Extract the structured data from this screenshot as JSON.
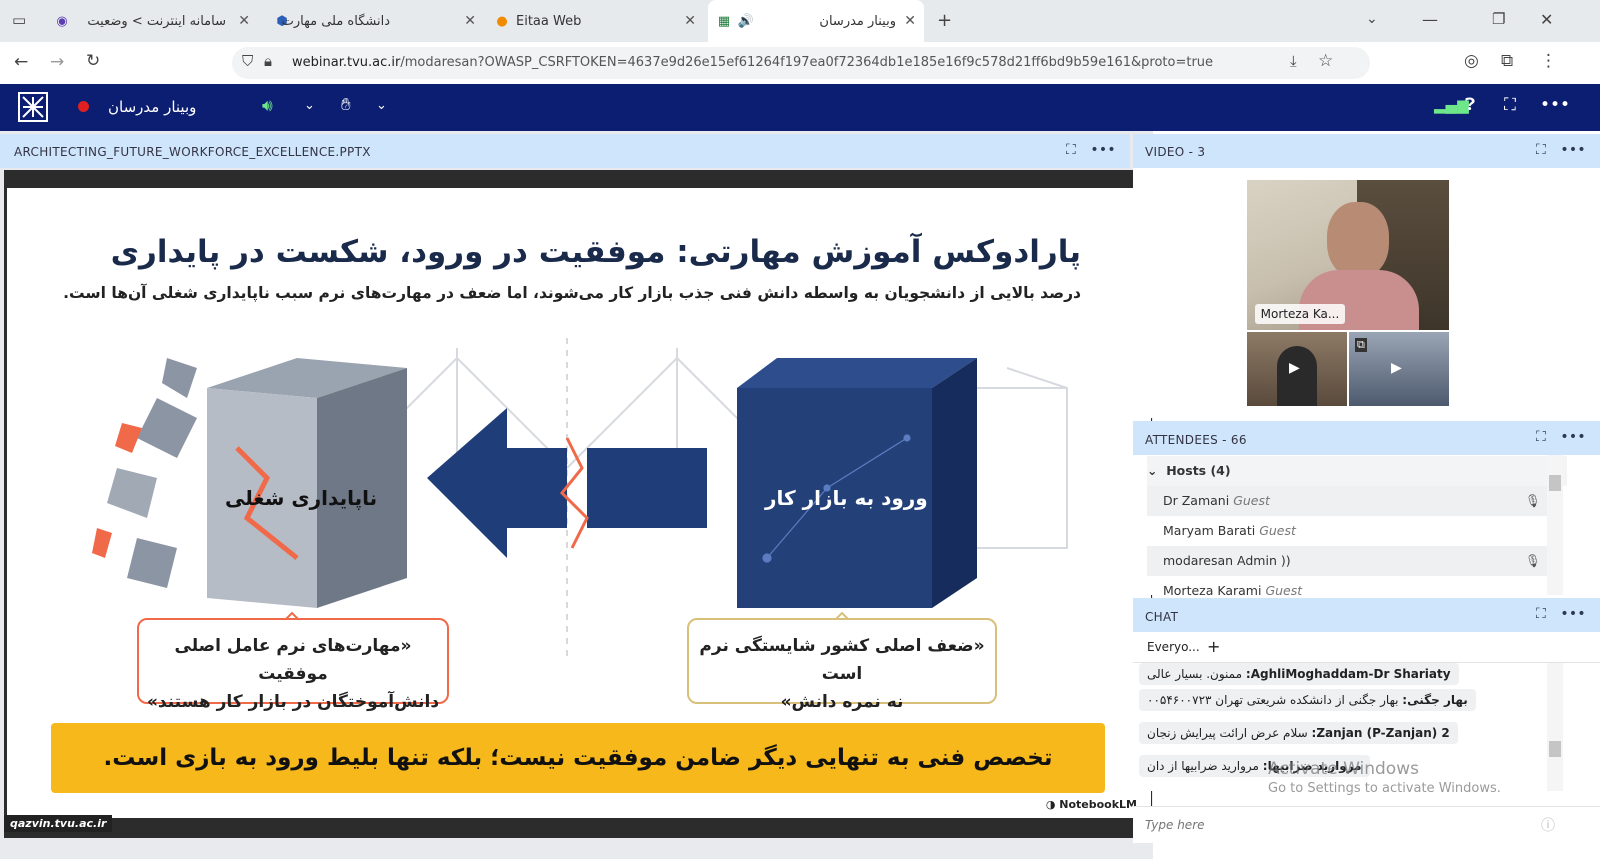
{
  "browser": {
    "tabs": [
      {
        "title": "سامانه اینترنت > وضعیت"
      },
      {
        "title": "دانشگاه ملی مهارت"
      },
      {
        "title": "Eitaa Web"
      },
      {
        "title": "وبینار مدرسان"
      }
    ],
    "url_host": "webinar.tvu.ac.ir",
    "url_rest": "/modaresan?OWASP_CSRFTOKEN=4637e9d26e15ef61264f197ea0f72364db1e185e16f9c578d21ff6bd9b59e161&proto=true"
  },
  "app": {
    "room_title": "وبینار مدرسان",
    "colors": {
      "header": "#0b1e72",
      "panel_head": "#cfe5fb",
      "accent": "#f6b81b",
      "record": "#e02020"
    }
  },
  "presentation": {
    "filename": "ARCHITECTING_FUTURE_WORKFORCE_EXCELLENCE.PPTX",
    "slide": {
      "title": "پارادوکس آموزش مهارتی: موفقیت در ورود، شکست در پایداری",
      "subtitle": "درصد بالایی از دانشجویان به واسطه دانش فنی جذب بازار کار می‌شوند، اما ضعف در مهارت‌های نرم سبب ناپایداری شغلی آن‌ها است.",
      "left_cube_label": "ناپایداری شغلی",
      "right_cube_label": "ورود به بازار کار",
      "left_quote_line1": "«مهارت‌های نرم عامل اصلی موفقیت",
      "left_quote_line2": "دانش‌آموختگان در بازار کار هستند»",
      "right_quote_line1": "«ضعف اصلی کشور شایستگی نرم است",
      "right_quote_line2": "نه نمره دانش»",
      "banner": "تخصص فنی به تنهایی دیگر ضامن موفقیت نیست؛ بلکه تنها بلیط ورود به بازی است.",
      "credit": "NotebookLM"
    },
    "watermark": "qazvin.tvu.ac.ir"
  },
  "video": {
    "label": "VIDEO",
    "count": "- 3",
    "main_name": "Morteza Ka..."
  },
  "attendees": {
    "label": "ATTENDEES",
    "count": "- 66",
    "group": "Hosts (4)",
    "items": [
      {
        "name": "Dr Zamani",
        "role": "Guest"
      },
      {
        "name": "Maryam Barati",
        "role": "Guest"
      },
      {
        "name": "modaresan Admin",
        "role": ""
      },
      {
        "name": "Morteza Karami",
        "role": "Guest"
      }
    ]
  },
  "chat": {
    "label": "CHAT",
    "tab": "Everyo...",
    "messages": [
      {
        "sender": "AghliMoghaddam-Dr Shariaty:",
        "text": "ممنون. بسیار عالی"
      },
      {
        "sender": "بهار جگنی:",
        "text": "بهار جگنی از دانشکده  شریعتی تهران  ۰۰۵۴۶۰۰۷۲۳"
      },
      {
        "sender": "Zanjan (P-Zanjan) 2:",
        "text": "سلام عرض ارائت پیرایش زنجان"
      },
      {
        "sender": "مروارید ضرابیها:",
        "text": "مروارید ضرابیها  از دان"
      }
    ],
    "placeholder": "Type here"
  },
  "os_overlay": {
    "line1": "Activate Windows",
    "line2": "Go to Settings to activate Windows."
  }
}
